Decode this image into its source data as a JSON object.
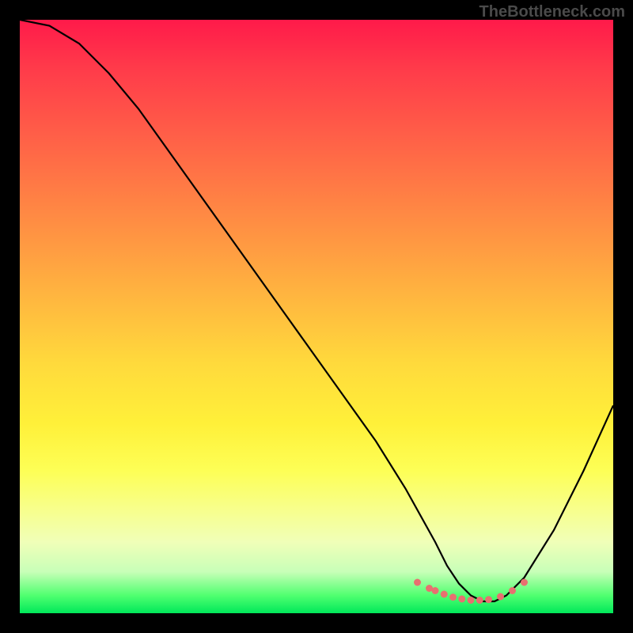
{
  "watermark": "TheBottleneck.com",
  "chart_data": {
    "type": "line",
    "title": "",
    "xlabel": "",
    "ylabel": "",
    "xlim": [
      0,
      100
    ],
    "ylim": [
      0,
      100
    ],
    "grid": false,
    "legend": false,
    "description": "Bottleneck curve over rainbow gradient background. V-shaped curve with minimum near x≈75-80. Small salmon-colored marker dots near the trough indicating optimal range.",
    "series": [
      {
        "name": "bottleneck-curve",
        "color": "#000000",
        "x": [
          0,
          5,
          10,
          15,
          20,
          25,
          30,
          35,
          40,
          45,
          50,
          55,
          60,
          65,
          70,
          72,
          74,
          76,
          78,
          80,
          82,
          85,
          90,
          95,
          100
        ],
        "values": [
          100,
          99,
          96,
          91,
          85,
          78,
          71,
          64,
          57,
          50,
          43,
          36,
          29,
          21,
          12,
          8,
          5,
          3,
          2,
          2,
          3,
          6,
          14,
          24,
          35
        ]
      }
    ],
    "markers": {
      "name": "optimal-range-dots",
      "color": "#e87070",
      "x": [
        67,
        69,
        70,
        71.5,
        73,
        74.5,
        76,
        77.5,
        79,
        81,
        83,
        85
      ],
      "values": [
        5.2,
        4.2,
        3.8,
        3.2,
        2.7,
        2.4,
        2.2,
        2.2,
        2.3,
        2.8,
        3.8,
        5.2
      ]
    },
    "background_gradient": {
      "type": "vertical",
      "stops": [
        {
          "pos": 0,
          "color": "#ff1a4a"
        },
        {
          "pos": 50,
          "color": "#ffda3c"
        },
        {
          "pos": 85,
          "color": "#f8ff88"
        },
        {
          "pos": 100,
          "color": "#00e85a"
        }
      ]
    }
  }
}
